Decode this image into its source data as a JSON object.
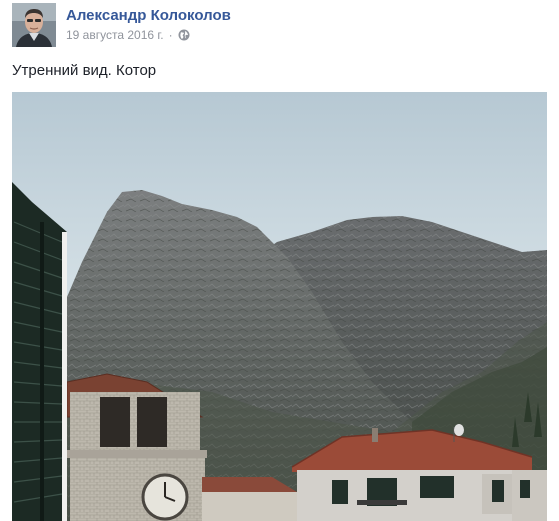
{
  "post": {
    "author_name": "Александр Колоколов",
    "date": "19 августа 2016 г.",
    "separator": "·",
    "privacy_icon": "globe-icon",
    "text": "Утренний вид. Котор"
  },
  "photo": {
    "subject": "mountain-landscape"
  },
  "colors": {
    "author_link": "#365899",
    "meta_text": "#90949c",
    "body_text": "#1d2129"
  }
}
